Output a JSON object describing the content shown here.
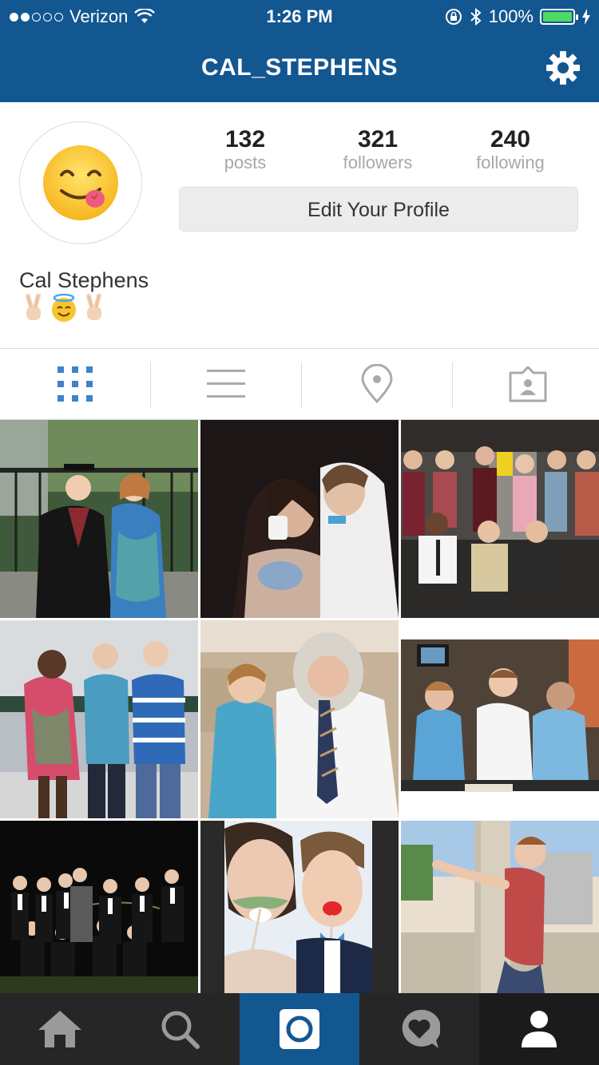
{
  "status_bar": {
    "carrier": "Verizon",
    "time": "1:26 PM",
    "battery": "100%"
  },
  "header": {
    "username": "CAL_STEPHENS",
    "settings_icon": "gear-icon"
  },
  "profile": {
    "avatar_emoji": "😋",
    "full_name": "Cal Stephens",
    "bio_emojis": [
      "✌🏻",
      "😇",
      "✌🏻"
    ],
    "stats": [
      {
        "count": "132",
        "label": "posts"
      },
      {
        "count": "321",
        "label": "followers"
      },
      {
        "count": "240",
        "label": "following"
      }
    ],
    "edit_button_label": "Edit Your Profile"
  },
  "tabs": [
    {
      "icon": "grid-icon",
      "active": true
    },
    {
      "icon": "list-icon",
      "active": false
    },
    {
      "icon": "location-pin-icon",
      "active": false
    },
    {
      "icon": "tagged-photos-icon",
      "active": false
    }
  ],
  "photos": [
    {
      "description_colors": [
        "#3b4a33",
        "#1a1a1a",
        "#3a6fb0"
      ]
    },
    {
      "description_colors": [
        "#1c1414",
        "#d9c7b8",
        "#f2f2f2"
      ]
    },
    {
      "description_colors": [
        "#6b6460",
        "#8e2f2f",
        "#e8a9b5"
      ]
    },
    {
      "description_colors": [
        "#b9c2c6",
        "#d64d6c",
        "#2f7fc2"
      ]
    },
    {
      "description_colors": [
        "#c9b59c",
        "#4aa6c8",
        "#f5f5f5"
      ]
    },
    {
      "description_colors": [
        "#4a3d33",
        "#5aa0d0",
        "#f5f5f5"
      ]
    },
    {
      "description_colors": [
        "#0a0a0a",
        "#1f1f1f",
        "#ffffff"
      ]
    },
    {
      "description_colors": [
        "#2a2a2a",
        "#e9c9b8",
        "#1e3c6e"
      ]
    },
    {
      "description_colors": [
        "#d6cbbb",
        "#b64a4a",
        "#8fb7d9"
      ]
    }
  ],
  "bottom_nav": [
    {
      "icon": "home-icon",
      "active": false
    },
    {
      "icon": "search-icon",
      "active": false
    },
    {
      "icon": "camera-icon",
      "active": true
    },
    {
      "icon": "activity-heart-icon",
      "active": false
    },
    {
      "icon": "profile-icon",
      "active": false
    }
  ],
  "colors": {
    "brand": "#135791",
    "nav_bg": "#262626",
    "tab_active": "#3a84c9",
    "tab_inactive": "#aaaaaa"
  }
}
